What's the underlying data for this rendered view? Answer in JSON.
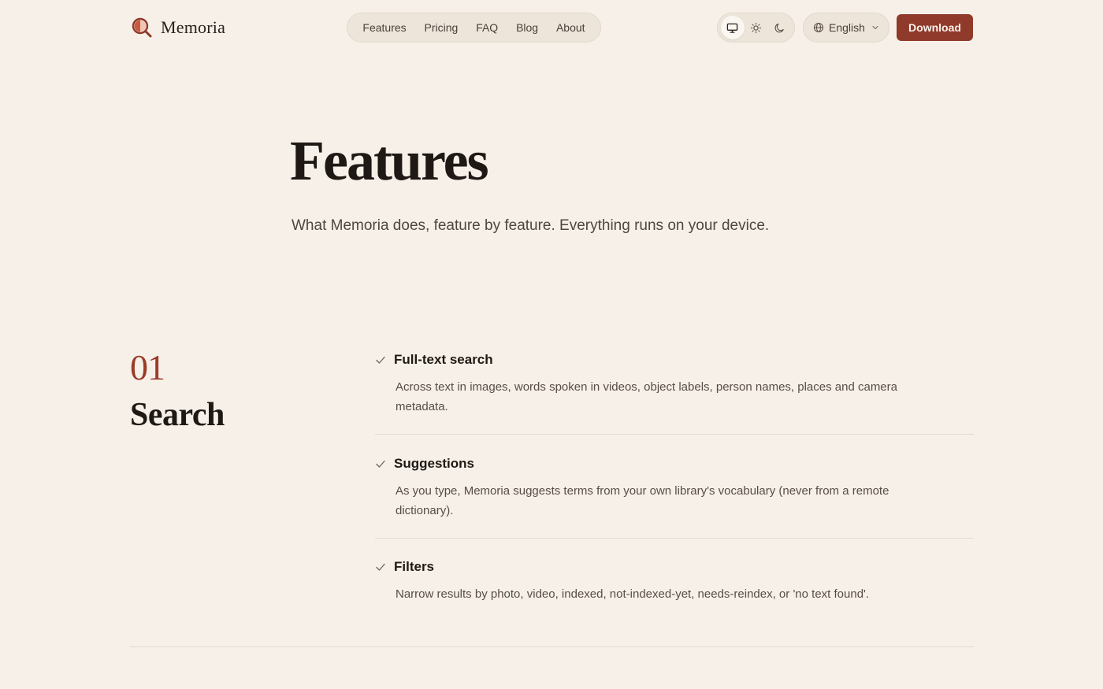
{
  "brand": {
    "name": "Memoria",
    "logo_icon": "magnifier-logo-icon",
    "accent": "#8f3a2a"
  },
  "nav": {
    "items": [
      {
        "label": "Features"
      },
      {
        "label": "Pricing"
      },
      {
        "label": "FAQ"
      },
      {
        "label": "Blog"
      },
      {
        "label": "About"
      }
    ]
  },
  "theme": {
    "options": [
      "monitor-icon",
      "sun-icon",
      "moon-icon"
    ],
    "selected": "monitor-icon"
  },
  "language": {
    "selected": "English"
  },
  "download": {
    "label": "Download"
  },
  "hero": {
    "title": "Features",
    "subtitle": "What Memoria does, feature by feature. Everything runs on your device."
  },
  "section": {
    "number": "01",
    "name": "Search",
    "features": [
      {
        "title": "Full-text search",
        "description": "Across text in images, words spoken in videos, object labels, person names, places and camera metadata."
      },
      {
        "title": "Suggestions",
        "description": "As you type, Memoria suggests terms from your own library's vocabulary (never from a remote dictionary)."
      },
      {
        "title": "Filters",
        "description": "Narrow results by photo, video, indexed, not-indexed-yet, needs-reindex, or 'no text found'."
      }
    ]
  },
  "colors": {
    "background": "#f6f0e8",
    "accent": "#8f3a2a",
    "number_accent": "#9b3b2a",
    "text": "#1f1915"
  }
}
